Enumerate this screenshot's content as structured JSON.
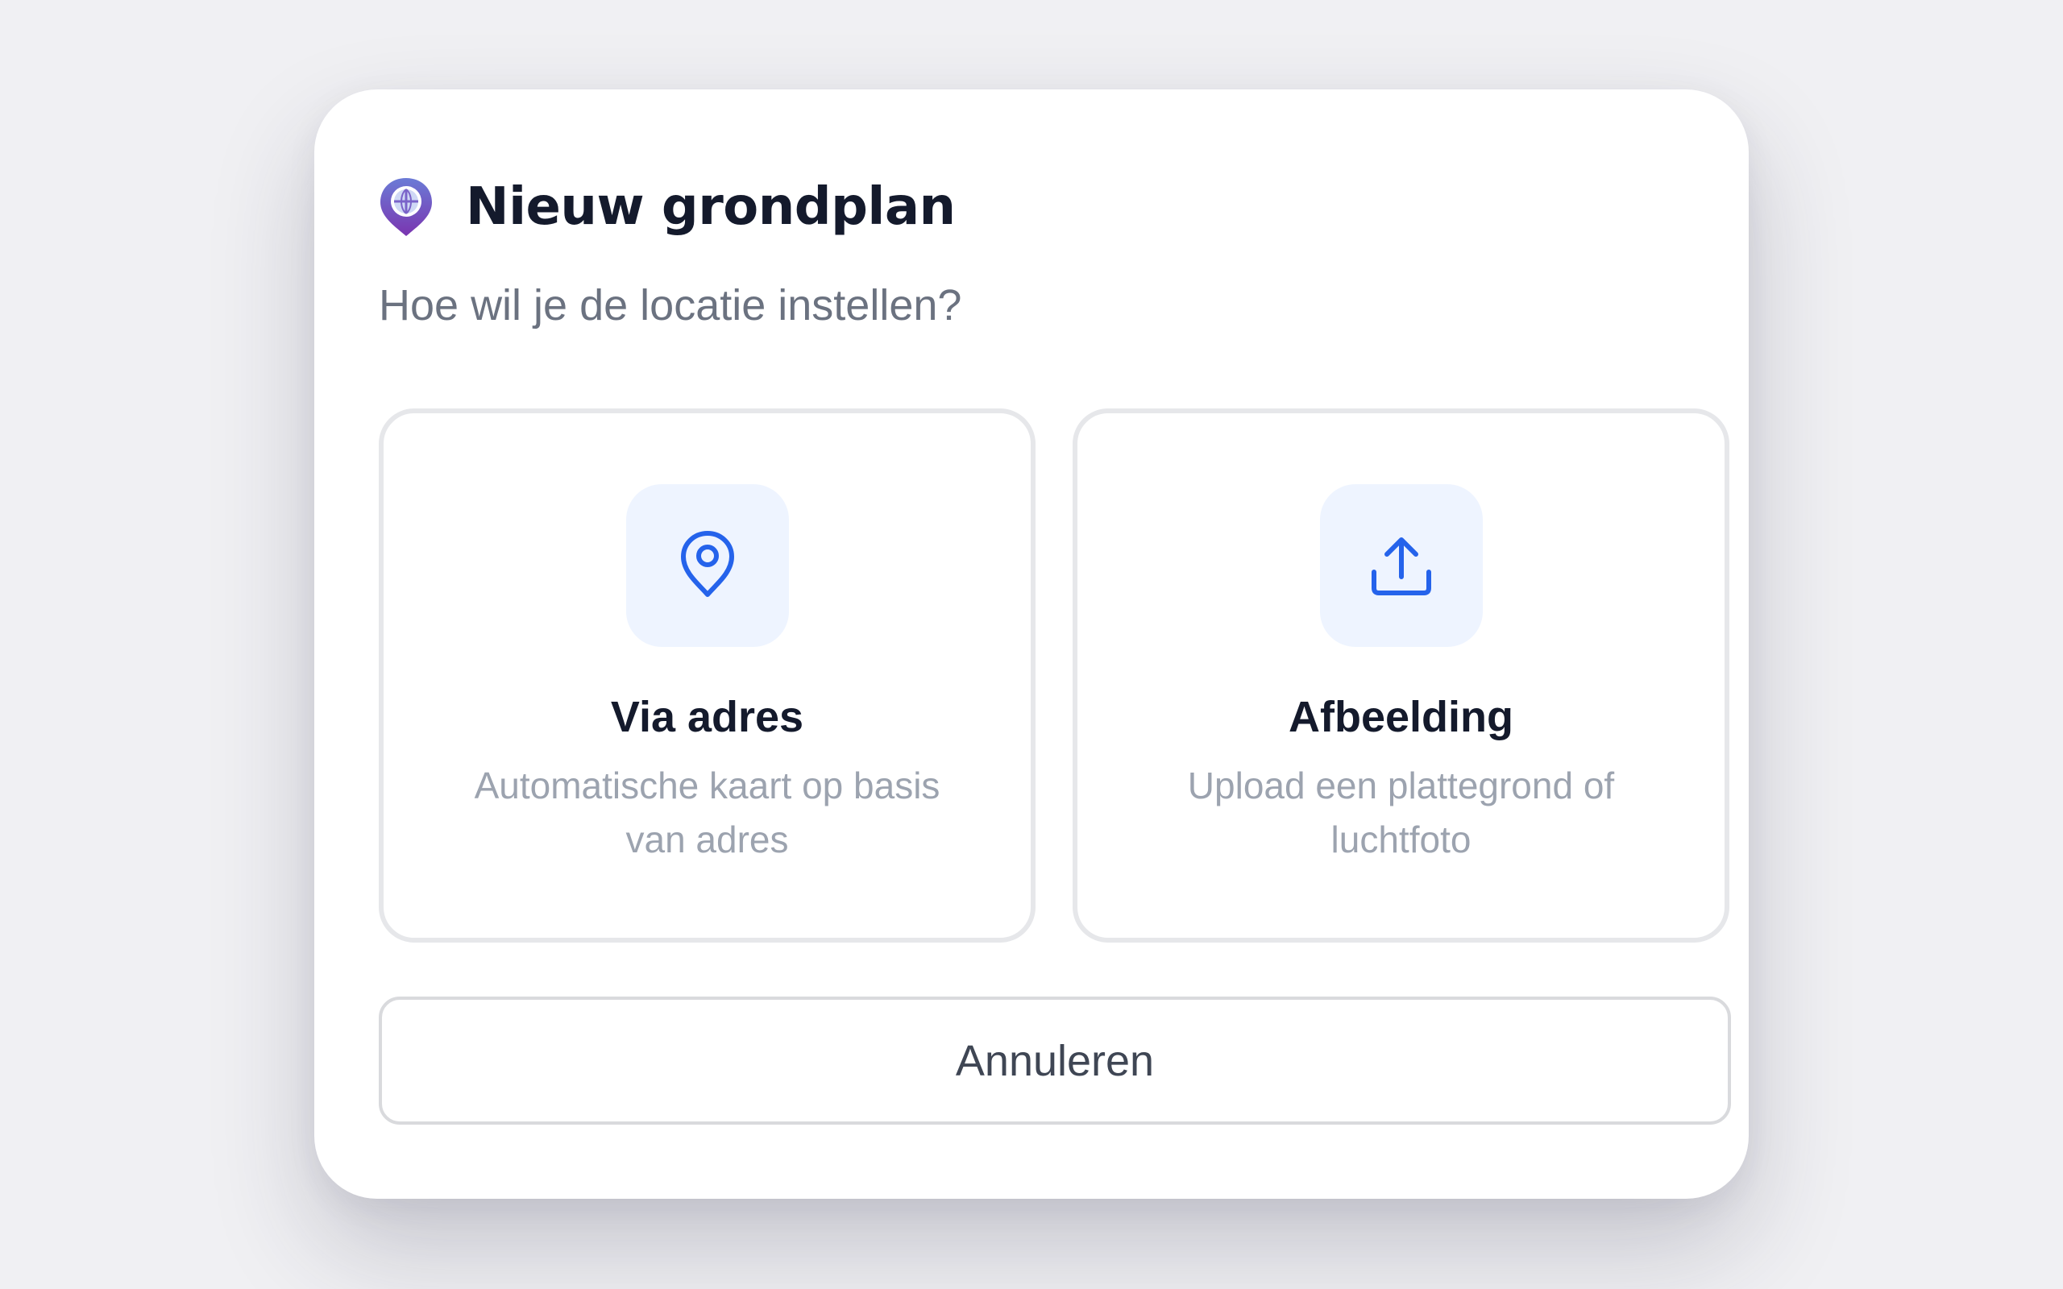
{
  "dialog": {
    "title": "Nieuw grondplan",
    "subtitle": "Hoe wil je de locatie instellen?",
    "logo_icon": "map-pin-globe-icon",
    "options": [
      {
        "title": "Via adres",
        "description": "Automatische kaart op basis van adres",
        "icon": "location-pin-icon"
      },
      {
        "title": "Afbeelding",
        "description": "Upload een plattegrond of luchtfoto",
        "icon": "upload-icon"
      }
    ],
    "cancel_label": "Annuleren"
  },
  "colors": {
    "accent": "#2563eb",
    "accent_soft": "#eef4ff",
    "logo_gradient_top": "#6b7bd6",
    "logo_gradient_bottom": "#7a35b0",
    "title": "#141a2c",
    "muted": "#9ca3af",
    "background": "#f0f0f3"
  }
}
